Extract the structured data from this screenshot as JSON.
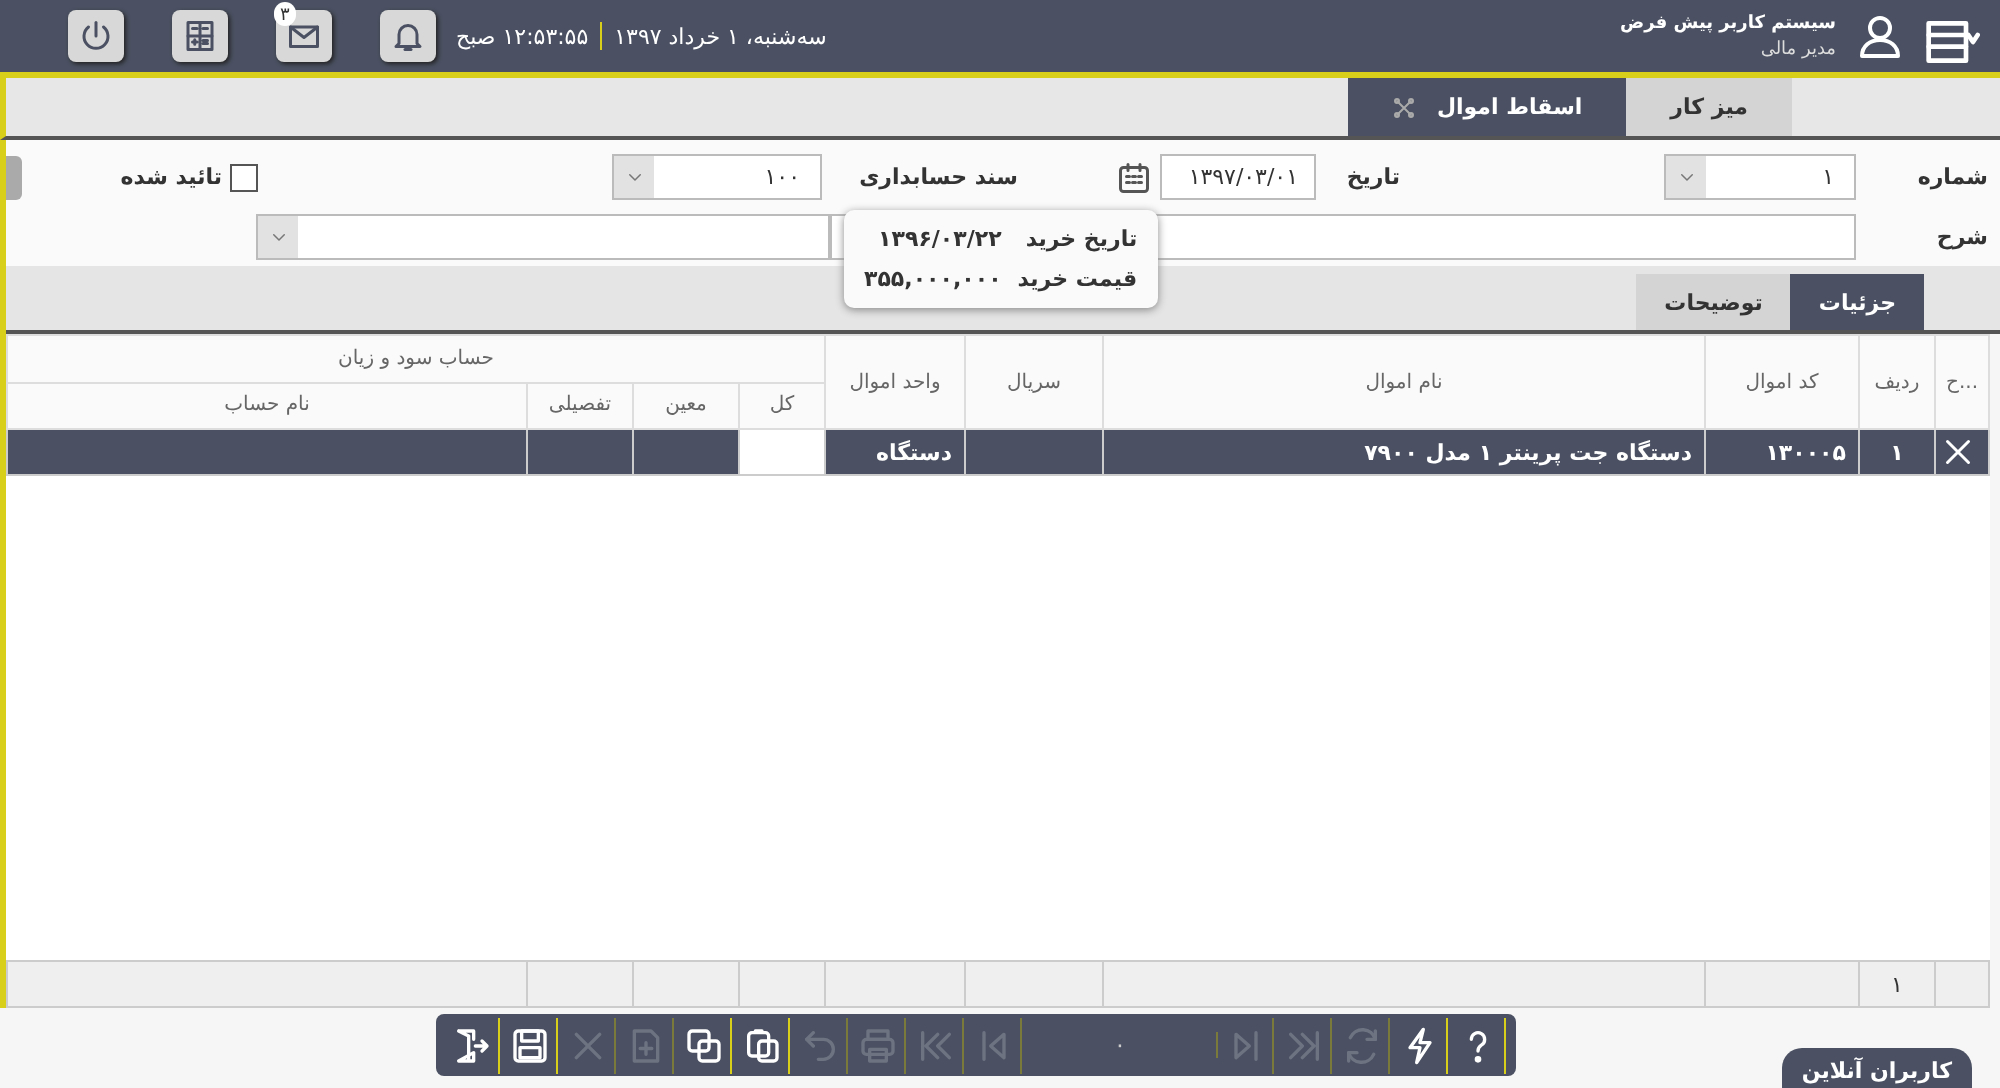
{
  "header": {
    "user_name": "سیستم کاربر پیش فرض",
    "user_role": "مدیر مالی",
    "date_text": "سه‌شنبه، ۱ خرداد ۱۳۹۷",
    "time_text": "۱۲:۵۳:۵۵ صبح",
    "mail_badge": "۳"
  },
  "tabs": [
    {
      "label": "میز کار",
      "selected": false
    },
    {
      "label": "اسقاط اموال",
      "selected": true
    }
  ],
  "form": {
    "number_label": "شماره",
    "number_value": "۱",
    "date_label": "تاریخ",
    "date_value": "۱۳۹۷/۰۳/۰۱",
    "voucher_label": "سند حسابداری",
    "voucher_value": "۱۰۰",
    "approved_label": "تائید شده",
    "approved_checked": false,
    "description_label": "شرح"
  },
  "tooltip": [
    {
      "label": "تاریخ خرید",
      "value": "۱۳۹۶/۰۳/۲۲"
    },
    {
      "label": "قیمت خرید",
      "value": "۳۵۵,۰۰۰,۰۰۰"
    }
  ],
  "detail_tabs": [
    {
      "label": "جزئیات",
      "selected": true
    },
    {
      "label": "توضیحات",
      "selected": false
    }
  ],
  "table": {
    "columns": [
      "...ح",
      "ردیف",
      "کد اموال",
      "نام اموال",
      "سریال",
      "واحد اموال"
    ],
    "group_header": "حساب سود و زیان",
    "group_columns": [
      "کل",
      "معین",
      "تفصیلی",
      "نام حساب"
    ],
    "rows": [
      {
        "selected": true,
        "cells": [
          "",
          "۱",
          "۱۳۰۰۰۵",
          "دستگاه جت پرینتر ۱ مدل ۷۹۰۰",
          "",
          "دستگاه"
        ]
      }
    ],
    "footer": {
      "row_count": "۱"
    }
  },
  "toolbar": {
    "buttons": [
      {
        "kind": "exit",
        "disabled": false
      },
      {
        "kind": "save",
        "disabled": false
      },
      {
        "kind": "delete",
        "disabled": true
      },
      {
        "kind": "new",
        "disabled": true
      },
      {
        "kind": "copy",
        "disabled": false
      },
      {
        "kind": "paste",
        "disabled": false
      },
      {
        "kind": "undo",
        "disabled": true
      },
      {
        "kind": "print",
        "disabled": true
      },
      {
        "kind": "first",
        "disabled": true
      },
      {
        "kind": "prev",
        "disabled": true
      },
      {
        "kind": "page"
      },
      {
        "kind": "next",
        "disabled": true
      },
      {
        "kind": "last",
        "disabled": true
      },
      {
        "kind": "refresh",
        "disabled": true
      },
      {
        "kind": "flash",
        "disabled": false
      },
      {
        "kind": "help",
        "disabled": false
      }
    ],
    "page_indicator": "۰"
  },
  "online_users": "کاربران آنلاین"
}
